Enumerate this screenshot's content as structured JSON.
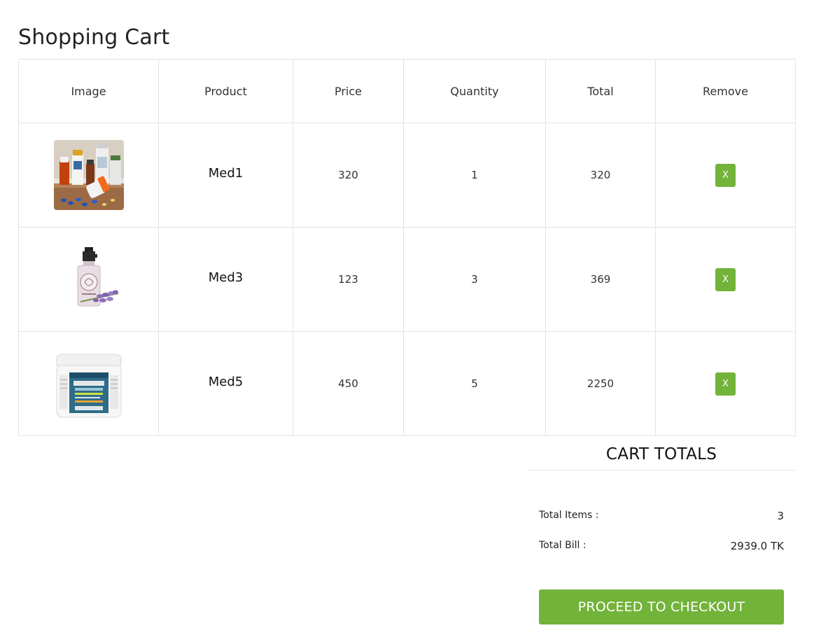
{
  "page": {
    "title": "Shopping Cart"
  },
  "table": {
    "headers": [
      "Image",
      "Product",
      "Price",
      "Quantity",
      "Total",
      "Remove"
    ],
    "rows": [
      {
        "image": "medicine-bottles-photo",
        "product": "Med1",
        "price": "320",
        "quantity": "1",
        "total": "320",
        "remove_label": "X"
      },
      {
        "image": "spray-bottle-photo",
        "product": "Med3",
        "price": "123",
        "quantity": "3",
        "total": "369",
        "remove_label": "X"
      },
      {
        "image": "pill-bottle-photo",
        "product": "Med5",
        "price": "450",
        "quantity": "5",
        "total": "2250",
        "remove_label": "X"
      }
    ]
  },
  "totals": {
    "title": "CART TOTALS",
    "items_label": "Total Items :",
    "items_value": "3",
    "bill_label": "Total Bill :",
    "bill_value": "2939.0 TK",
    "checkout_label": "PROCEED TO CHECKOUT"
  },
  "colors": {
    "accent": "#72b33a",
    "border": "#e3e3e3"
  }
}
